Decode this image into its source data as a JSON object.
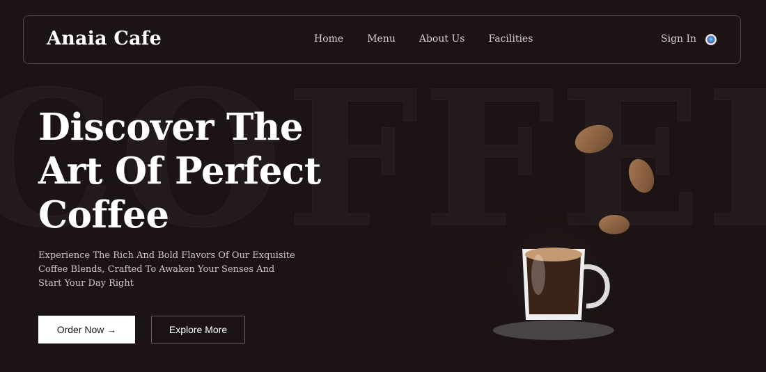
{
  "brand": {
    "name": "Anaia Cafe"
  },
  "nav": {
    "links": [
      {
        "label": "Home"
      },
      {
        "label": "Menu"
      },
      {
        "label": "About Us"
      },
      {
        "label": "Facilities"
      }
    ],
    "sign_in": "Sign In",
    "profile_icon": "user-circle-icon"
  },
  "hero": {
    "watermark": "COFFEE",
    "title_line1": "Discover The",
    "title_line2": "Art Of Perfect",
    "title_line3": "Coffee",
    "subtitle": "Experience The Rich And Bold Flavors Of Our Exquisite Coffee Blends, Crafted To Awaken Your Senses And Start Your Day Right",
    "primary_button": "Order Now →",
    "secondary_button": "Explore More"
  },
  "colors": {
    "background": "#1c1314",
    "text_primary": "#ffffff",
    "coffee_bean": "#8a5f3f",
    "coffee_liquid": "#3b2318",
    "crema": "#c49a73",
    "saucer": "#4a4445"
  }
}
